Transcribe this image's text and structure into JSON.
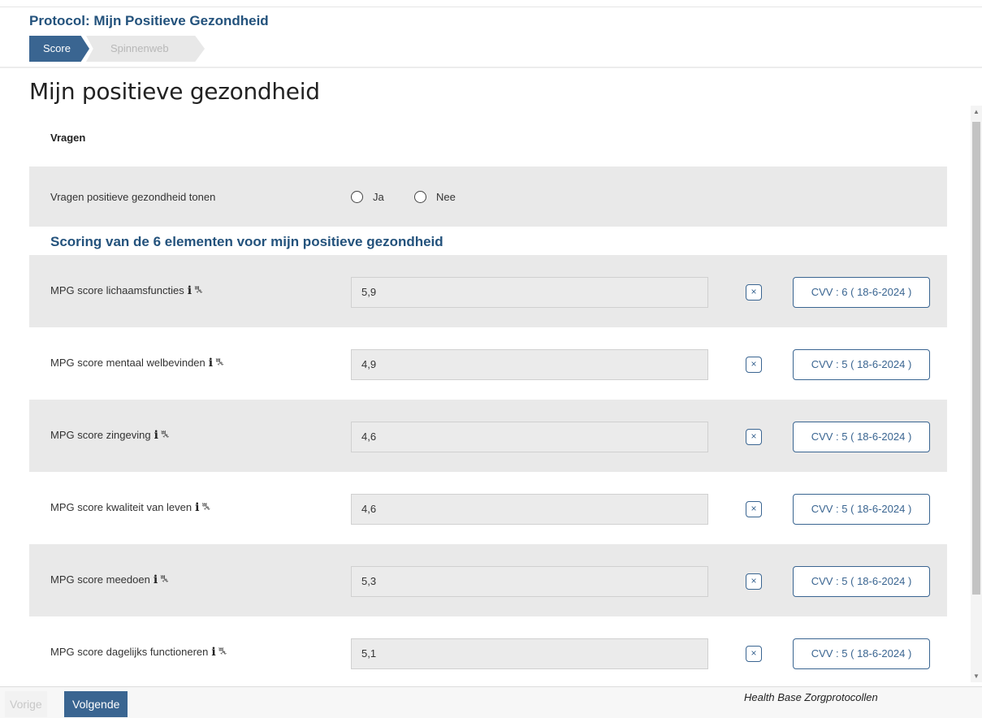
{
  "header": {
    "protocol_title": "Protocol: Mijn Positieve Gezondheid",
    "steps": [
      {
        "label": "Score",
        "active": true
      },
      {
        "label": "Spinnenweb",
        "active": false
      }
    ]
  },
  "page": {
    "heading": "Mijn positieve gezondheid",
    "section_label": "Vragen",
    "question": {
      "label": "Vragen positieve gezondheid tonen",
      "options": [
        "Ja",
        "Nee"
      ],
      "selected": null
    },
    "sub_heading": "Scoring van de 6 elementen voor mijn positieve gezondheid",
    "scores": [
      {
        "label": "MPG score lichaamsfuncties",
        "value": "5,9",
        "cvv": "CVV : 6 ( 18-6-2024 )"
      },
      {
        "label": "MPG score mentaal welbevinden",
        "value": "4,9",
        "cvv": "CVV : 5 ( 18-6-2024 )"
      },
      {
        "label": "MPG score zingeving",
        "value": "4,6",
        "cvv": "CVV : 5 ( 18-6-2024 )"
      },
      {
        "label": "MPG score kwaliteit van leven",
        "value": "4,6",
        "cvv": "CVV : 5 ( 18-6-2024 )"
      },
      {
        "label": "MPG score meedoen",
        "value": "5,3",
        "cvv": "CVV : 5 ( 18-6-2024 )"
      },
      {
        "label": "MPG score dagelijks functioneren",
        "value": "5,1",
        "cvv": "CVV : 5 ( 18-6-2024 )"
      }
    ],
    "icons": {
      "info": "info-icon",
      "graph": "graph-icon",
      "clear": "clear-icon"
    },
    "info_glyph": "i",
    "graph_glyph": "ꔩ",
    "clear_glyph": "×"
  },
  "footer": {
    "prev_label": "Vorige",
    "next_label": "Volgende",
    "brand": "Health Base Zorgprotocollen"
  },
  "colors": {
    "accent": "#3a6591",
    "title": "#23527c",
    "row_grey": "#e9e9e9"
  }
}
